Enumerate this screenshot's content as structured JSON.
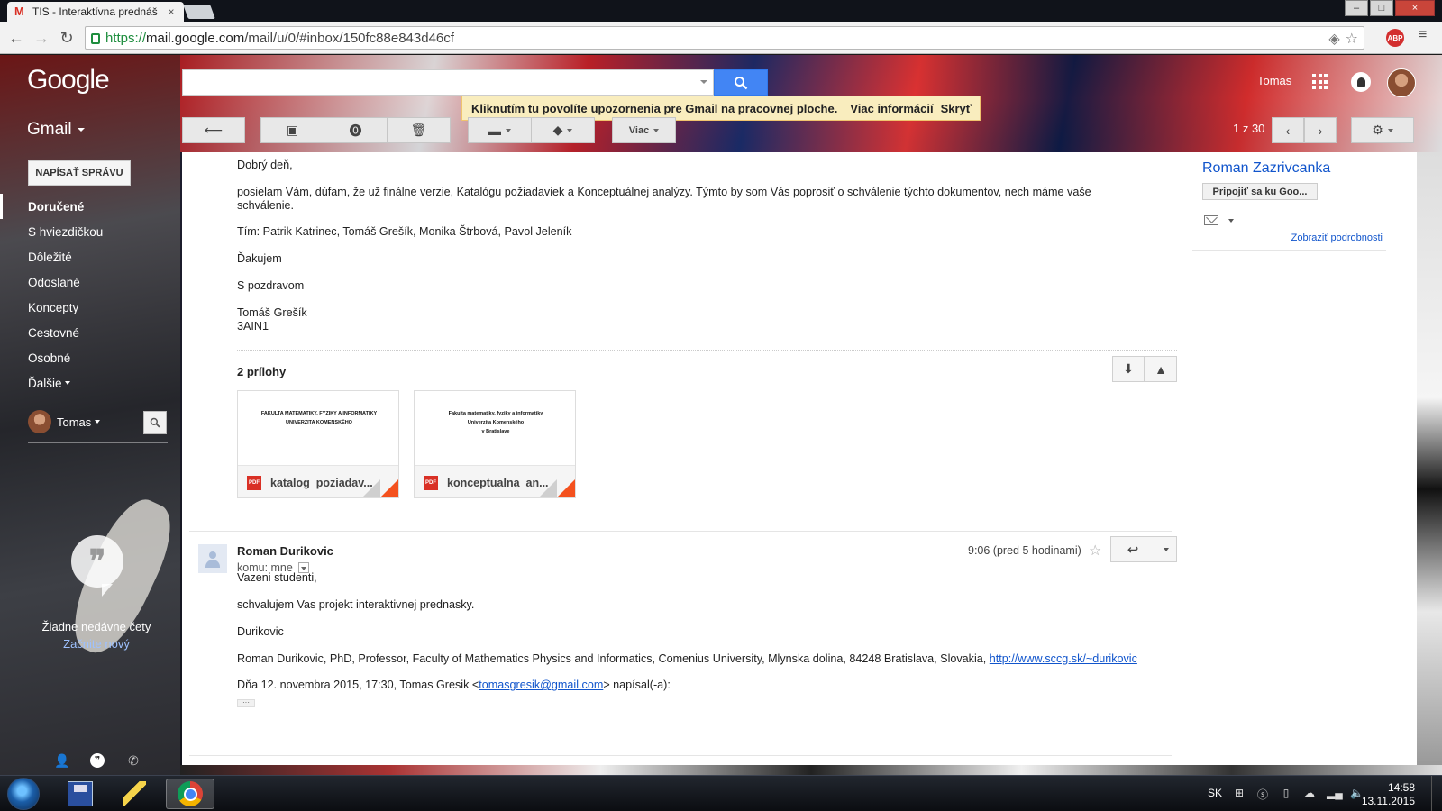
{
  "browser": {
    "tab_title": "TIS - Interaktívna prednáš",
    "tab_close": "×",
    "url_secure": "https://",
    "url_host": "mail.google.com",
    "url_path": "/mail/u/0/#inbox/150fc88e843d46cf",
    "abp": "ABP",
    "win_min": "–",
    "win_max": "□",
    "win_close": "×"
  },
  "header": {
    "logo": "Google",
    "user_name": "Tomas",
    "gmail_label": "Gmail"
  },
  "notice": {
    "link1": "Kliknutím tu povolíte",
    "text": "upozornenia pre Gmail na pracovnej ploche.",
    "link2": "Viac informácií",
    "link3": "Skryť"
  },
  "toolbar": {
    "more_label": "Viac",
    "pager": "1 z 30"
  },
  "sidebar": {
    "compose_label": "NAPÍSAŤ SPRÁVU",
    "items": [
      {
        "label": "Doručené"
      },
      {
        "label": "S hviezdičkou"
      },
      {
        "label": "Dôležité"
      },
      {
        "label": "Odoslané"
      },
      {
        "label": "Koncepty"
      },
      {
        "label": "Cestovné"
      },
      {
        "label": "Osobné"
      },
      {
        "label": "Ďalšie"
      }
    ],
    "hangout_user": "Tomas",
    "no_chats": "Žiadne nedávne čety",
    "start_new": "Začnite nový"
  },
  "message1": {
    "greeting": "Dobrý deň,",
    "body1": "posielam Vám, dúfam, že už finálne verzie, Katalógu požiadaviek a Konceptuálnej analýzy. Týmto by som Vás poprosiť o schválenie týchto dokumentov, nech máme vaše schválenie.",
    "team": "Tím: Patrik Katrinec, Tomáš Grešík, Monika Štrbová, Pavol Jeleník",
    "thanks": "Ďakujem",
    "regards": "S pozdravom",
    "sig_name": "Tomáš Grešík",
    "sig_class": "3AIN1",
    "attachments_title": "2 prílohy",
    "attachments": [
      {
        "filename": "katalog_poziadav...",
        "preview_lines": [
          "FAKULTA MATEMATIKY, FYZIKY A INFORMATIKY",
          "UNIVERZITA KOMENSKÉHO"
        ]
      },
      {
        "filename": "konceptualna_an...",
        "preview_lines": [
          "Fakulta matematiky, fyziky a informatiky",
          "Univerzita Komenského",
          "v Bratislave"
        ]
      }
    ]
  },
  "message2": {
    "sender": "Roman Durikovic",
    "to_label": "komu: mne",
    "time": "9:06 (pred 5 hodinami)",
    "greeting": "Vazeni studenti,",
    "body": "schvalujem Vas projekt interaktivnej prednasky.",
    "sign": "Durikovic",
    "sig_full": "Roman Durikovic, PhD, Professor, Faculty of Mathematics Physics and Informatics, Comenius University, Mlynska dolina, 84248 Bratislava, Slovakia,",
    "sig_link": "http://www.sccg.sk/~durikovic",
    "quote_prefix": "Dňa 12. novembra 2015, 17:30, Tomas Gresik <",
    "quote_email": "tomasgresik@gmail.com",
    "quote_suffix": "> napísal(-a):",
    "ellipsis": "···"
  },
  "contact": {
    "name": "Roman Zazrivcanka",
    "connect_label": "Pripojiť sa ku Goo...",
    "details_label": "Zobraziť podrobnosti"
  },
  "taskbar": {
    "lang": "SK",
    "time": "14:58",
    "date": "13.11.2015"
  },
  "colors": {
    "accent_blue": "#4285f4",
    "link_blue": "#1155cc",
    "notice_bg": "#f9edbe",
    "pdf_red": "#d93025"
  }
}
